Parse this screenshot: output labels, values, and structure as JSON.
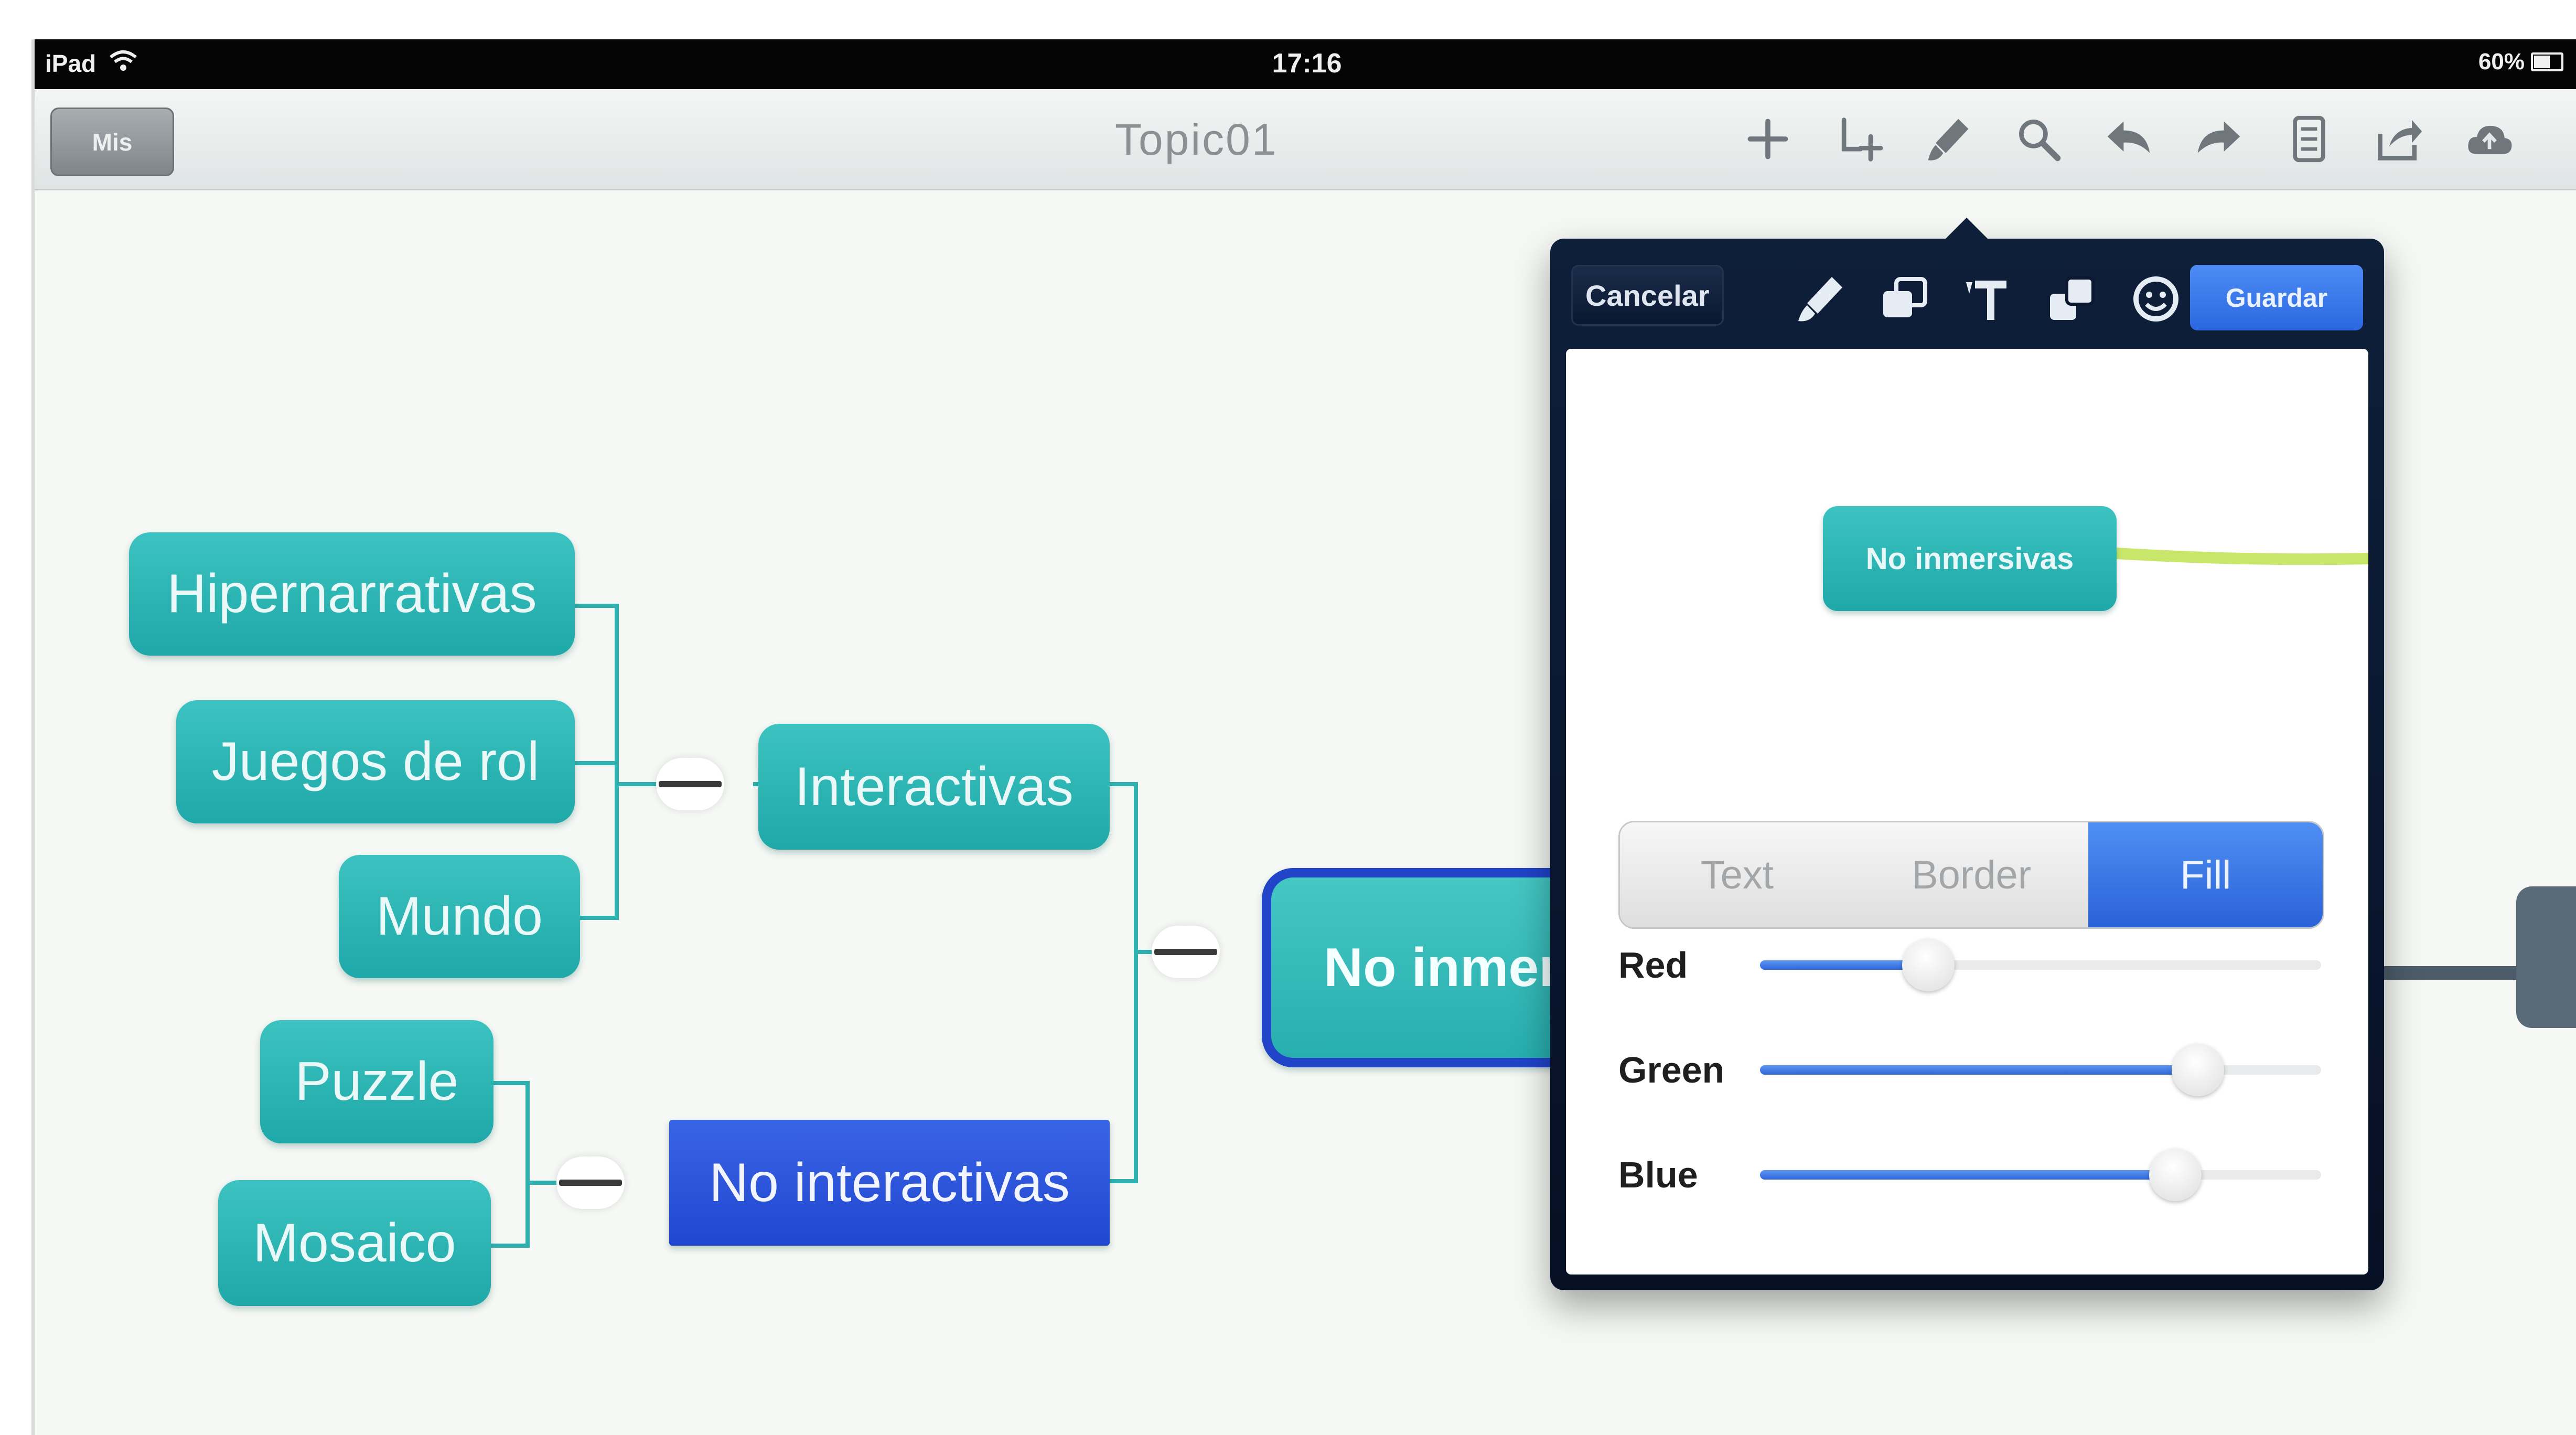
{
  "status_bar": {
    "device": "iPad",
    "time": "17:16",
    "battery": "60%"
  },
  "nav_bar": {
    "back_button_label": "Mis",
    "title": "Topic01",
    "tools": [
      "add-topic-icon",
      "add-subtopic-icon",
      "style-brush-icon",
      "search-icon",
      "undo-icon",
      "redo-icon",
      "document-icon",
      "share-icon",
      "cloud-icon"
    ]
  },
  "mind_map": {
    "central_topic": "No inmersivas",
    "branches": [
      {
        "label": "Interactivas",
        "children": [
          "Hipernarrativas",
          "Juegos de rol",
          "Mundo"
        ]
      },
      {
        "label": "No interactivas",
        "children": [
          "Puzzle",
          "Mosaico"
        ]
      }
    ]
  },
  "style_popover": {
    "cancel_label": "Cancelar",
    "save_label": "Guardar",
    "tool_icons": [
      "brush-icon",
      "layers-icon",
      "text-icon",
      "copy-style-icon",
      "emoji-icon"
    ],
    "preview_topic_label": "No inmersivas",
    "segments": [
      "Text",
      "Border",
      "Fill"
    ],
    "active_segment": "Fill",
    "sliders": [
      {
        "label": "Red",
        "value": 0.3
      },
      {
        "label": "Green",
        "value": 0.78
      },
      {
        "label": "Blue",
        "value": 0.74
      }
    ]
  },
  "colors": {
    "topic_teal": "#2db5b3",
    "selected_blue": "#2a55db",
    "accent_blue": "#2f6ee6",
    "status_bar_bg": "#050505"
  }
}
